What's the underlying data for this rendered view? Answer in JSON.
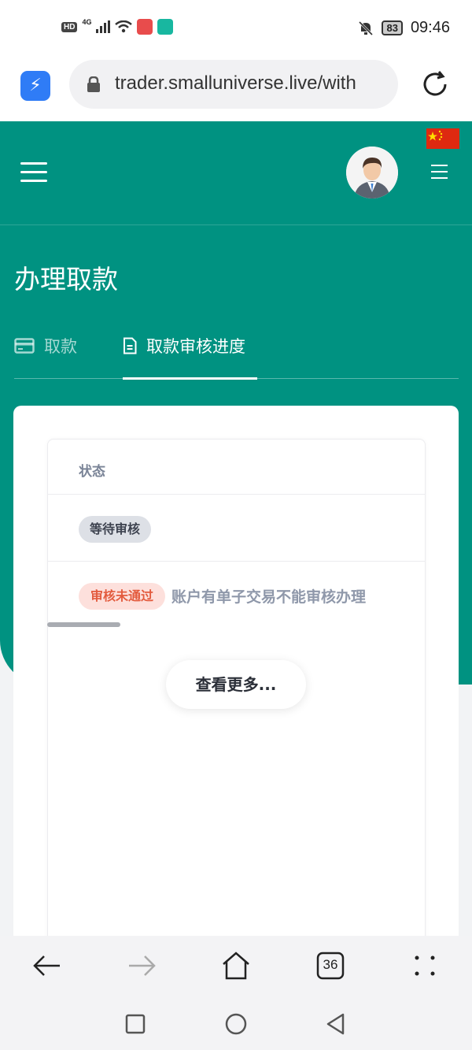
{
  "statusbar": {
    "hd": "HD",
    "network": "4G",
    "battery": "83",
    "time": "09:46"
  },
  "browser": {
    "url": "trader.smalluniverse.live/with",
    "tab_count": "36"
  },
  "header": {
    "page_title": "办理取款"
  },
  "tabs": [
    {
      "label": "取款",
      "icon": "card-icon",
      "active": false
    },
    {
      "label": "取款审核进度",
      "icon": "document-icon",
      "active": true
    }
  ],
  "table": {
    "column_header": "状态",
    "rows": [
      {
        "status": "等待审核",
        "status_color": "#dde0e6"
      },
      {
        "status": "审核未通过",
        "status_color": "#fde0dc",
        "reason": "账户有单子交易不能审核办理"
      }
    ],
    "load_more_label": "查看更多..."
  },
  "colors": {
    "brand_green": "#009281",
    "reject_red": "#e35b3e"
  }
}
